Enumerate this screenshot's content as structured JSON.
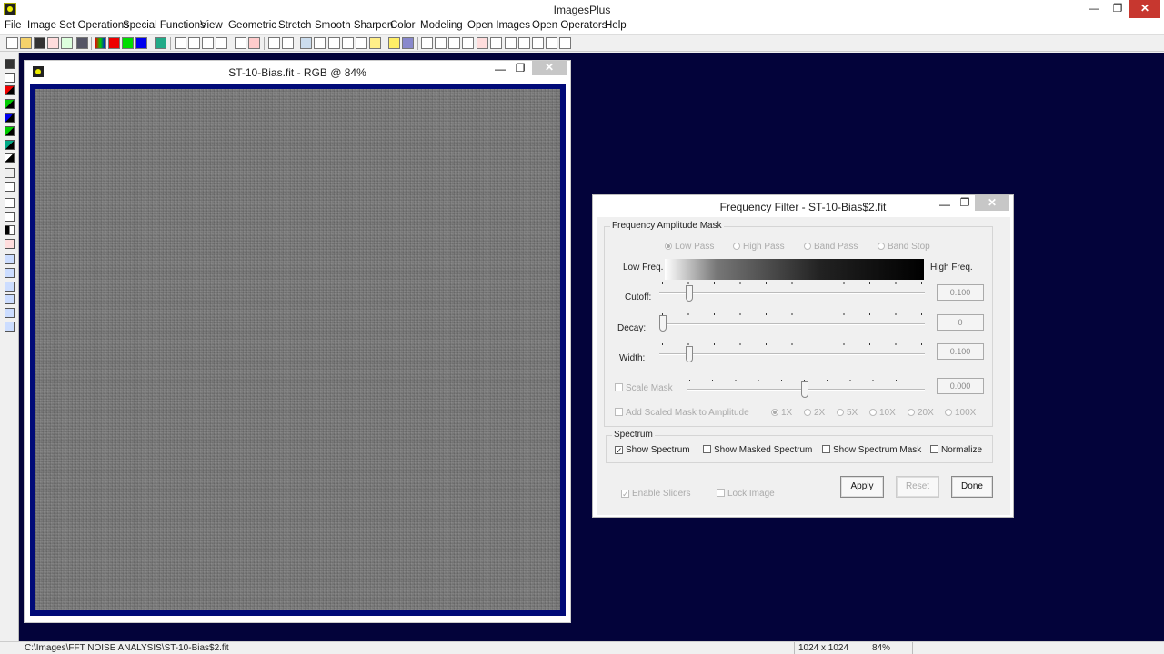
{
  "app": {
    "title": "ImagesPlus"
  },
  "window_controls": {
    "minimize": "—",
    "maximize": "❐",
    "close": "✕"
  },
  "menu": [
    "File",
    "Image Set Operations",
    "Special Functions",
    "View",
    "Geometric",
    "Stretch",
    "Smooth Sharpen",
    "Color",
    "Modeling",
    "Open Images",
    "Open Operators",
    "Help"
  ],
  "image_window": {
    "title": "ST-10-Bias.fit - RGB @ 84%",
    "minimize": "—",
    "maximize": "❐",
    "close": "✕"
  },
  "dialog": {
    "title": "Frequency Filter - ST-10-Bias$2.fit",
    "minimize": "—",
    "maximize": "❐",
    "close": "✕",
    "mask_group": "Frequency Amplitude Mask",
    "filter_types": [
      "Low Pass",
      "High Pass",
      "Band Pass",
      "Band Stop"
    ],
    "low_freq": "Low Freq.",
    "high_freq": "High Freq.",
    "cutoff_label": "Cutoff:",
    "cutoff_value": "0.100",
    "decay_label": "Decay:",
    "decay_value": "0",
    "width_label": "Width:",
    "width_value": "0.100",
    "scale_mask": "Scale Mask",
    "scale_value": "0.000",
    "add_scaled": "Add Scaled Mask to Amplitude",
    "scale_options": [
      "1X",
      "2X",
      "5X",
      "10X",
      "20X",
      "100X"
    ],
    "spectrum_group": "Spectrum",
    "show_spectrum": "Show Spectrum",
    "show_masked": "Show Masked Spectrum",
    "show_mask": "Show Spectrum Mask",
    "normalize": "Normalize",
    "enable_sliders": "Enable Sliders",
    "lock_image": "Lock Image",
    "apply": "Apply",
    "reset": "Reset",
    "done": "Done",
    "check_mark": "✓"
  },
  "status": {
    "path": "C:\\Images\\FFT NOISE ANALYSIS\\ST-10-Bias$2.fit",
    "size": "1024 x 1024",
    "zoom": "84%"
  }
}
